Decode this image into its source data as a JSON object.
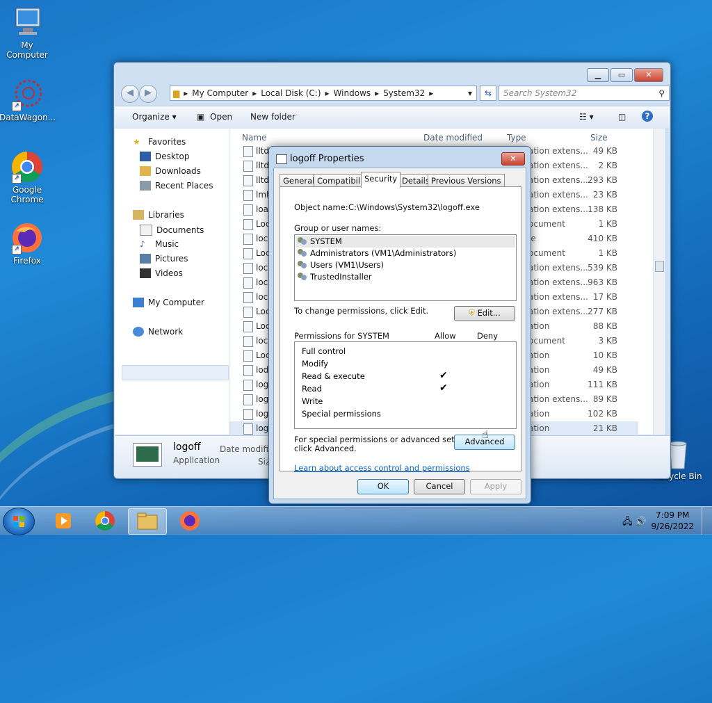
{
  "desktop": {
    "icons": [
      {
        "label": "My Computer"
      },
      {
        "label": "DataWagon..."
      },
      {
        "label": "Google Chrome"
      },
      {
        "label": "Firefox"
      },
      {
        "label": "Recycle Bin"
      }
    ]
  },
  "explorer": {
    "breadcrumb": [
      "My Computer",
      "Local Disk (C:)",
      "Windows",
      "System32"
    ],
    "search_placeholder": "Search System32",
    "toolbar": {
      "organize": "Organize ▾",
      "open": "Open",
      "new_folder": "New folder"
    },
    "nav": {
      "favorites": "Favorites",
      "desktop": "Desktop",
      "downloads": "Downloads",
      "recent": "Recent Places",
      "libraries": "Libraries",
      "documents": "Documents",
      "music": "Music",
      "pictures": "Pictures",
      "videos": "Videos",
      "computer": "My Computer",
      "network": "Network"
    },
    "columns": {
      "name": "Name",
      "date": "Date modified",
      "type": "Type",
      "size": "Size"
    },
    "rows": [
      {
        "name": "lltd",
        "type": "ation extens...",
        "size": "49 KB"
      },
      {
        "name": "lltd",
        "type": "ation extens...",
        "size": "2 KB"
      },
      {
        "name": "lltd",
        "type": "ation extens...",
        "size": "293 KB"
      },
      {
        "name": "lmh",
        "type": "ation extens...",
        "size": "23 KB"
      },
      {
        "name": "loa",
        "type": "ation extens...",
        "size": "138 KB"
      },
      {
        "name": "Loc",
        "type": "ocument",
        "size": "1 KB"
      },
      {
        "name": "loc",
        "type": "le",
        "size": "410 KB"
      },
      {
        "name": "Loc",
        "type": "ocument",
        "size": "1 KB"
      },
      {
        "name": "loc",
        "type": "ation extens...",
        "size": "539 KB"
      },
      {
        "name": "loc",
        "type": "ation extens...",
        "size": "963 KB"
      },
      {
        "name": "loc",
        "type": "ation extens...",
        "size": "17 KB"
      },
      {
        "name": "Loc",
        "type": "ation extens...",
        "size": "277 KB"
      },
      {
        "name": "Loc",
        "type": "ation",
        "size": "88 KB"
      },
      {
        "name": "loc",
        "type": "ocument",
        "size": "3 KB"
      },
      {
        "name": "Loc",
        "type": "ation",
        "size": "10 KB"
      },
      {
        "name": "lod",
        "type": "ation",
        "size": "49 KB"
      },
      {
        "name": "log",
        "type": "ation",
        "size": "111 KB"
      },
      {
        "name": "log",
        "type": "ation extens...",
        "size": "89 KB"
      },
      {
        "name": "log",
        "type": "ation",
        "size": "102 KB"
      },
      {
        "name": "log",
        "type": "ation",
        "size": "21 KB"
      }
    ],
    "details": {
      "name": "logoff",
      "type": "Application",
      "date_label": "Date modifie",
      "size_label": "Siz"
    }
  },
  "dialog": {
    "title": "logoff Properties",
    "tabs": [
      "General",
      "Compatibility",
      "Security",
      "Details",
      "Previous Versions"
    ],
    "object_label": "Object name:",
    "object_value": "C:\\Windows\\System32\\logoff.exe",
    "group_label": "Group or user names:",
    "users": [
      "SYSTEM",
      "Administrators (VM1\\Administrators)",
      "Users (VM1\\Users)",
      "TrustedInstaller"
    ],
    "change_text": "To change permissions, click Edit.",
    "edit_btn": "Edit...",
    "perm_label": "Permissions for SYSTEM",
    "allow": "Allow",
    "deny": "Deny",
    "permissions": [
      {
        "name": "Full control",
        "allow": ""
      },
      {
        "name": "Modify",
        "allow": ""
      },
      {
        "name": "Read & execute",
        "allow": "✔"
      },
      {
        "name": "Read",
        "allow": "✔"
      },
      {
        "name": "Write",
        "allow": ""
      },
      {
        "name": "Special permissions",
        "allow": ""
      }
    ],
    "special_text1": "For special permissions or advanced settings,",
    "special_text2": "click Advanced.",
    "advanced_btn": "Advanced",
    "learn_link": "Learn about access control and permissions",
    "ok": "OK",
    "cancel": "Cancel",
    "apply": "Apply"
  },
  "taskbar": {
    "time": "7:09 PM",
    "date": "9/26/2022"
  }
}
